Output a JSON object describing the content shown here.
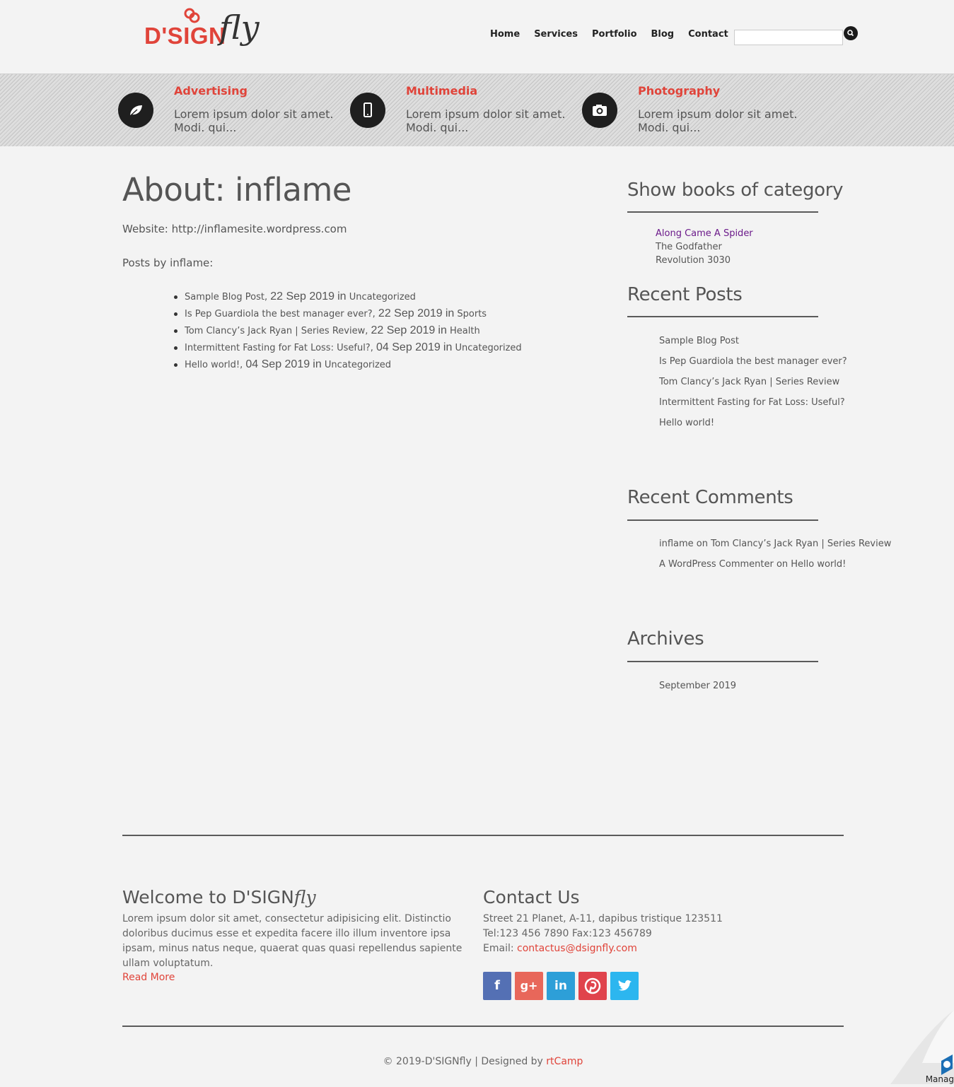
{
  "brand": {
    "name_main": "D'SIGN",
    "name_fly": "fly"
  },
  "nav": {
    "items": [
      "Home",
      "Services",
      "Portfolio",
      "Blog",
      "Contact"
    ],
    "search_placeholder": ""
  },
  "services": [
    {
      "title": "Advertising",
      "text": "Lorem ipsum dolor sit amet. Modi. qui...",
      "icon": "leaf-icon"
    },
    {
      "title": "Multimedia",
      "text": "Lorem ipsum dolor sit amet. Modi. qui...",
      "icon": "mobile-icon"
    },
    {
      "title": "Photography",
      "text": "Lorem ipsum dolor sit amet. Modi. qui...",
      "icon": "camera-icon"
    }
  ],
  "main": {
    "title": "About: inflame",
    "website": "Website: http://inflamesite.wordpress.com",
    "posts_by": "Posts by inflame:",
    "posts": [
      {
        "title": "Sample Blog Post",
        "date": "22 Sep 2019",
        "category": "Uncategorized"
      },
      {
        "title": "Is Pep Guardiola the best manager ever?",
        "date": "22 Sep 2019",
        "category": "Sports"
      },
      {
        "title": "Tom Clancy’s Jack Ryan | Series Review",
        "date": "22 Sep 2019",
        "category": "Health"
      },
      {
        "title": "Intermittent Fasting for Fat Loss: Useful?",
        "date": "04 Sep 2019",
        "category": "Uncategorized"
      },
      {
        "title": "Hello world!",
        "date": "04 Sep 2019",
        "category": "Uncategorized"
      }
    ],
    "sep_comma": ",",
    "sep_in": "in"
  },
  "sidebar": {
    "books_title": "Show books of category",
    "books": [
      "Along Came A Spider",
      "The Godfather",
      "Revolution 3030"
    ],
    "recent_posts_title": "Recent Posts",
    "recent_posts": [
      "Sample Blog Post",
      "Is Pep Guardiola the best manager ever?",
      "Tom Clancy’s Jack Ryan | Series Review",
      "Intermittent Fasting for Fat Loss: Useful?",
      "Hello world!"
    ],
    "recent_comments_title": "Recent Comments",
    "recent_comments": [
      "inflame on Tom Clancy’s Jack Ryan | Series Review",
      "A WordPress Commenter on Hello world!"
    ],
    "archives_title": "Archives",
    "archives": [
      "September 2019"
    ]
  },
  "footer": {
    "welcome_title_main": "Welcome to D'SIGN",
    "welcome_title_fly": "fly",
    "welcome_text": "Lorem ipsum dolor sit amet, consectetur adipisicing elit. Distinctio doloribus ducimus esse et expedita facere illo illum inventore ipsa ipsam, minus natus neque, quaerat quas quasi repellendus sapiente ullam voluptatum.",
    "read_more": "Read More",
    "contact_title": "Contact Us",
    "address": "Street 21 Planet, A-11, dapibus tristique 123511",
    "phones": "Tel:123 456 7890 Fax:123 456789",
    "email_label": "Email: ",
    "email": "contactus@dsignfly.com",
    "social": [
      {
        "name": "facebook",
        "glyph": "f",
        "color": "#5470b4"
      },
      {
        "name": "google-plus",
        "glyph": "g+",
        "color": "#e8675a"
      },
      {
        "name": "linkedin",
        "glyph": "in",
        "color": "#2d9fd8"
      },
      {
        "name": "pinterest",
        "glyph": "P",
        "color": "#e0434c"
      },
      {
        "name": "twitter",
        "glyph": "t",
        "color": "#2cb6ef"
      }
    ],
    "copyright_prefix": "© 2019-D'SIGNfly | Designed by ",
    "copyright_link": "rtCamp",
    "corner_label": "Manag"
  },
  "colors": {
    "accent": "#e0443a",
    "text": "#555555",
    "visited": "#6b1a8a"
  }
}
